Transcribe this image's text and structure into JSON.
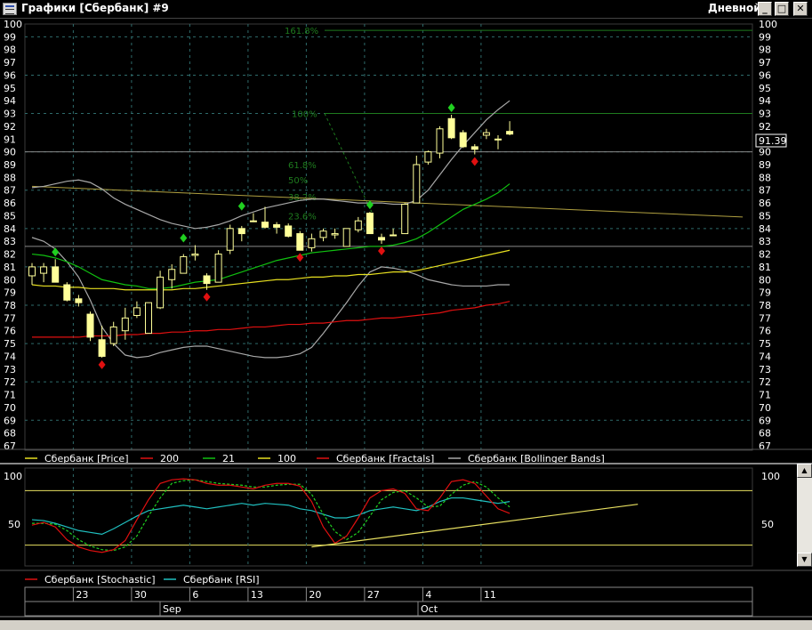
{
  "window": {
    "title": "Графики [Сбербанк] #9",
    "period": "Дневной",
    "minimize_glyph": "_",
    "maximize_glyph": "□",
    "close_glyph": "✕",
    "icon": "chart-window-icon"
  },
  "colors": {
    "background": "#000000",
    "grid": "#2e6b6b",
    "axis_text": "#ffffff",
    "candle_up": "#000000",
    "candle_down": "#ffff99",
    "candle_outline": "#ffff99",
    "ma200": "#e01010",
    "ma21": "#10c010",
    "ma100": "#e8e020",
    "bollinger": "#a8a8a8",
    "fractal_up": "#20d020",
    "fractal_down": "#e01010",
    "fib": "#1e7a1e",
    "stochastic": "#e01010",
    "stochastic_signal": "#20d020",
    "rsi": "#20c0c0",
    "osc_levels": "#e8e060"
  },
  "price_axis": {
    "min": 67,
    "max": 100
  },
  "last_price": "91.39",
  "fib_labels": [
    "161.8%",
    "100%",
    "61.8%",
    "50%",
    "38.2%",
    "23.6%"
  ],
  "legend_main": [
    {
      "label": "Сбербанк [Price]",
      "color": "#e8e020"
    },
    {
      "label": "200",
      "color": "#e01010"
    },
    {
      "label": "21",
      "color": "#10c010"
    },
    {
      "label": "100",
      "color": "#e8e020"
    },
    {
      "label": "Сбербанк [Fractals]",
      "color": "#e01010"
    },
    {
      "label": "Сбербанк [Bollinger Bands]",
      "color": "#a8a8a8"
    }
  ],
  "legend_osc": [
    {
      "label": "Сбербанк [Stochastic]",
      "color": "#e01010"
    },
    {
      "label": "Сбербанк [RSI]",
      "color": "#20c0c0"
    }
  ],
  "osc_axis": {
    "labels": [
      "100",
      "50"
    ]
  },
  "time_axis": {
    "days": [
      "23",
      "30",
      "6",
      "13",
      "20",
      "27",
      "4",
      "11"
    ],
    "months": [
      "Sep",
      "Oct"
    ]
  },
  "chart_data": {
    "type": "candlestick",
    "ylim": [
      67,
      100
    ],
    "candles": [
      {
        "o": 80.3,
        "h": 81.3,
        "l": 79.6,
        "c": 81.0
      },
      {
        "o": 80.5,
        "h": 81.3,
        "l": 79.8,
        "c": 81.0
      },
      {
        "o": 81.0,
        "h": 81.6,
        "l": 79.8,
        "c": 79.8
      },
      {
        "o": 79.6,
        "h": 79.8,
        "l": 78.3,
        "c": 78.4
      },
      {
        "o": 78.5,
        "h": 78.8,
        "l": 77.9,
        "c": 78.2
      },
      {
        "o": 77.3,
        "h": 77.5,
        "l": 75.2,
        "c": 75.5
      },
      {
        "o": 75.3,
        "h": 76.4,
        "l": 73.9,
        "c": 74.0
      },
      {
        "o": 75.0,
        "h": 76.7,
        "l": 74.8,
        "c": 76.3
      },
      {
        "o": 76.0,
        "h": 77.8,
        "l": 75.3,
        "c": 77.0
      },
      {
        "o": 77.2,
        "h": 78.3,
        "l": 77.0,
        "c": 77.8
      },
      {
        "o": 75.8,
        "h": 78.2,
        "l": 75.8,
        "c": 78.2
      },
      {
        "o": 77.8,
        "h": 80.7,
        "l": 77.7,
        "c": 80.2
      },
      {
        "o": 80.0,
        "h": 81.2,
        "l": 79.3,
        "c": 80.8
      },
      {
        "o": 80.5,
        "h": 82.0,
        "l": 80.5,
        "c": 81.8
      },
      {
        "o": 81.9,
        "h": 82.7,
        "l": 81.5,
        "c": 82.0
      },
      {
        "o": 80.3,
        "h": 80.5,
        "l": 79.2,
        "c": 79.7
      },
      {
        "o": 79.8,
        "h": 82.3,
        "l": 79.8,
        "c": 82.0
      },
      {
        "o": 82.3,
        "h": 84.3,
        "l": 82.0,
        "c": 84.0
      },
      {
        "o": 84.0,
        "h": 84.2,
        "l": 83.0,
        "c": 83.6
      },
      {
        "o": 84.6,
        "h": 85.2,
        "l": 84.5,
        "c": 84.6
      },
      {
        "o": 84.5,
        "h": 85.7,
        "l": 84.0,
        "c": 84.1
      },
      {
        "o": 84.3,
        "h": 84.5,
        "l": 83.6,
        "c": 84.1
      },
      {
        "o": 84.2,
        "h": 84.4,
        "l": 83.3,
        "c": 83.4
      },
      {
        "o": 83.6,
        "h": 83.8,
        "l": 82.3,
        "c": 82.3
      },
      {
        "o": 82.5,
        "h": 83.6,
        "l": 82.2,
        "c": 83.2
      },
      {
        "o": 83.3,
        "h": 84.0,
        "l": 83.0,
        "c": 83.8
      },
      {
        "o": 83.5,
        "h": 84.0,
        "l": 83.2,
        "c": 83.6
      },
      {
        "o": 82.6,
        "h": 84.0,
        "l": 82.6,
        "c": 84.0
      },
      {
        "o": 83.9,
        "h": 84.9,
        "l": 83.7,
        "c": 84.6
      },
      {
        "o": 85.2,
        "h": 85.3,
        "l": 83.6,
        "c": 83.6
      },
      {
        "o": 83.3,
        "h": 83.6,
        "l": 82.8,
        "c": 83.1
      },
      {
        "o": 83.5,
        "h": 84.0,
        "l": 83.4,
        "c": 83.5
      },
      {
        "o": 83.6,
        "h": 86.0,
        "l": 83.6,
        "c": 85.9
      },
      {
        "o": 86.0,
        "h": 89.7,
        "l": 86.0,
        "c": 89.0
      },
      {
        "o": 89.2,
        "h": 90.1,
        "l": 89.0,
        "c": 90.0
      },
      {
        "o": 89.9,
        "h": 92.0,
        "l": 89.5,
        "c": 91.8
      },
      {
        "o": 92.6,
        "h": 92.9,
        "l": 91.0,
        "c": 91.1
      },
      {
        "o": 91.5,
        "h": 91.7,
        "l": 90.3,
        "c": 90.4
      },
      {
        "o": 90.4,
        "h": 90.6,
        "l": 89.8,
        "c": 90.2
      },
      {
        "o": 91.3,
        "h": 91.8,
        "l": 91.0,
        "c": 91.5
      },
      {
        "o": 91.0,
        "h": 91.3,
        "l": 90.2,
        "c": 91.0
      },
      {
        "o": 91.6,
        "h": 92.4,
        "l": 91.3,
        "c": 91.39
      }
    ],
    "ma21": [
      82.0,
      81.9,
      81.7,
      81.4,
      81.0,
      80.5,
      80.0,
      79.8,
      79.6,
      79.5,
      79.3,
      79.3,
      79.4,
      79.6,
      79.8,
      79.9,
      80.0,
      80.3,
      80.6,
      80.9,
      81.2,
      81.5,
      81.7,
      81.9,
      82.1,
      82.2,
      82.3,
      82.4,
      82.5,
      82.6,
      82.6,
      82.7,
      82.9,
      83.2,
      83.7,
      84.3,
      84.9,
      85.5,
      85.9,
      86.3,
      86.8,
      87.5
    ],
    "ma100": [
      79.6,
      79.5,
      79.5,
      79.4,
      79.4,
      79.3,
      79.3,
      79.3,
      79.2,
      79.2,
      79.2,
      79.2,
      79.2,
      79.3,
      79.3,
      79.4,
      79.5,
      79.6,
      79.7,
      79.8,
      79.9,
      80.0,
      80.0,
      80.1,
      80.2,
      80.2,
      80.3,
      80.3,
      80.4,
      80.4,
      80.5,
      80.6,
      80.6,
      80.7,
      80.9,
      81.1,
      81.3,
      81.5,
      81.7,
      81.9,
      82.1,
      82.3
    ],
    "ma200": [
      75.5,
      75.5,
      75.5,
      75.5,
      75.5,
      75.6,
      75.6,
      75.6,
      75.7,
      75.7,
      75.8,
      75.8,
      75.9,
      75.9,
      76.0,
      76.0,
      76.1,
      76.1,
      76.2,
      76.3,
      76.3,
      76.4,
      76.5,
      76.5,
      76.6,
      76.6,
      76.7,
      76.8,
      76.8,
      76.9,
      77.0,
      77.0,
      77.1,
      77.2,
      77.3,
      77.4,
      77.6,
      77.7,
      77.8,
      78.0,
      78.1,
      78.3
    ],
    "bb_upper": [
      87.2,
      87.3,
      87.5,
      87.7,
      87.8,
      87.6,
      87.1,
      86.4,
      85.9,
      85.5,
      85.1,
      84.7,
      84.4,
      84.2,
      84.0,
      84.1,
      84.3,
      84.6,
      85.0,
      85.3,
      85.6,
      85.8,
      86.0,
      86.2,
      86.3,
      86.3,
      86.2,
      86.1,
      86.0,
      86.0,
      86.0,
      85.9,
      85.9,
      86.2,
      87.0,
      88.2,
      89.4,
      90.5,
      91.5,
      92.5,
      93.3,
      94.0
    ],
    "bb_lower": [
      83.3,
      83.0,
      82.4,
      81.4,
      80.2,
      78.4,
      76.3,
      75.0,
      74.1,
      73.9,
      74.0,
      74.3,
      74.5,
      74.7,
      74.8,
      74.8,
      74.6,
      74.4,
      74.2,
      74.0,
      73.9,
      73.9,
      74.0,
      74.2,
      74.7,
      75.8,
      77.0,
      78.2,
      79.5,
      80.6,
      81.0,
      80.9,
      80.7,
      80.4,
      80.0,
      79.8,
      79.6,
      79.5,
      79.5,
      79.5,
      79.6,
      79.6
    ],
    "fractals_up": [
      [
        2,
        81.6
      ],
      [
        13,
        82.7
      ],
      [
        18,
        85.2
      ],
      [
        29,
        85.3
      ],
      [
        36,
        92.9
      ]
    ],
    "fractals_down": [
      [
        6,
        73.9
      ],
      [
        15,
        79.2
      ],
      [
        23,
        82.3
      ],
      [
        30,
        82.8
      ],
      [
        38,
        89.8
      ]
    ],
    "horizontal_levels": [
      90,
      82.6
    ],
    "fib_levels": [
      {
        "label": "161.8%",
        "value": 99.5
      },
      {
        "label": "100%",
        "value": 93.0
      },
      {
        "label": "61.8%",
        "value": 89.0
      },
      {
        "label": "50%",
        "value": 87.8
      },
      {
        "label": "38.2%",
        "value": 86.5
      },
      {
        "label": "23.6%",
        "value": 85.0
      }
    ],
    "trendline": {
      "from": [
        0,
        87.3
      ],
      "to": [
        61,
        84.9
      ]
    },
    "stochastic": [
      42,
      45,
      40,
      26,
      18,
      14,
      12,
      15,
      25,
      48,
      70,
      88,
      92,
      93,
      92,
      88,
      86,
      86,
      84,
      82,
      86,
      88,
      88,
      85,
      68,
      40,
      22,
      30,
      50,
      72,
      80,
      82,
      77,
      60,
      58,
      72,
      90,
      92,
      88,
      74,
      60,
      55
    ],
    "stochastic_signal": [
      44,
      44,
      43,
      36,
      26,
      19,
      15,
      14,
      18,
      30,
      52,
      72,
      88,
      91,
      92,
      90,
      88,
      87,
      86,
      84,
      84,
      86,
      87,
      87,
      76,
      54,
      35,
      26,
      34,
      52,
      70,
      78,
      80,
      72,
      62,
      63,
      76,
      86,
      90,
      84,
      72,
      62
    ],
    "rsi": [
      48,
      47,
      44,
      40,
      36,
      34,
      32,
      38,
      45,
      52,
      58,
      60,
      62,
      64,
      62,
      60,
      62,
      64,
      66,
      64,
      66,
      65,
      64,
      60,
      58,
      54,
      50,
      50,
      53,
      58,
      60,
      62,
      60,
      58,
      62,
      68,
      72,
      72,
      70,
      68,
      66,
      68
    ],
    "osc_trendline": {
      "from": [
        24,
        18
      ],
      "to": [
        52,
        65
      ]
    },
    "osc_levels": [
      80,
      20
    ]
  }
}
